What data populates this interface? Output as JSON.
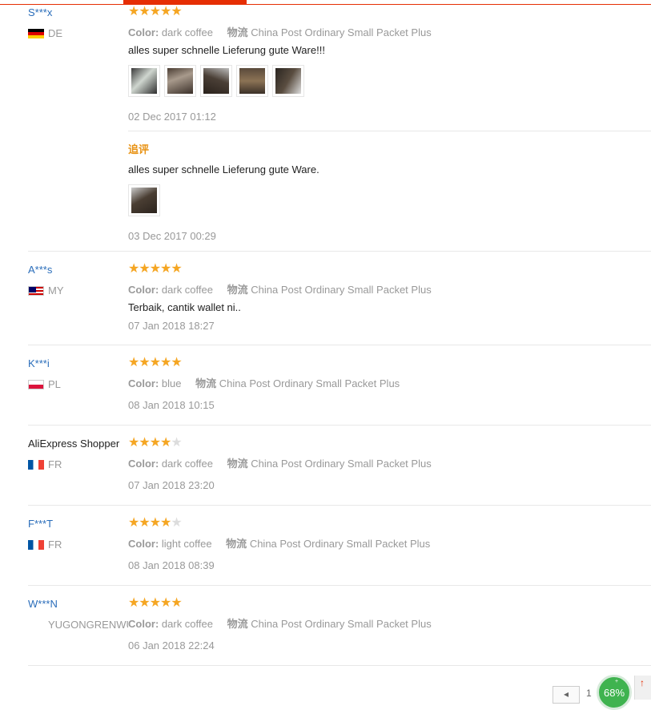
{
  "reviews": [
    {
      "user": "S***x",
      "country": "DE",
      "flag": "flag-de",
      "stars": 5,
      "color_label": "Color:",
      "color_value": "dark coffee",
      "shipping_label": "物流",
      "shipping_value": "China Post Ordinary Small Packet Plus",
      "text": "alles super schnelle Lieferung gute Ware!!!",
      "date": "02 Dec 2017 01:12",
      "followup": {
        "label": "追评",
        "text": "alles super schnelle Lieferung gute Ware.",
        "date": "03 Dec 2017 00:29"
      }
    },
    {
      "user": "A***s",
      "country": "MY",
      "flag": "flag-my",
      "stars": 5,
      "color_label": "Color:",
      "color_value": "dark coffee",
      "shipping_label": "物流",
      "shipping_value": "China Post Ordinary Small Packet Plus",
      "text": "Terbaik, cantik wallet ni..",
      "date": "07 Jan 2018 18:27"
    },
    {
      "user": "K***i",
      "country": "PL",
      "flag": "flag-pl",
      "stars": 5,
      "color_label": "Color:",
      "color_value": "blue",
      "shipping_label": "物流",
      "shipping_value": "China Post Ordinary Small Packet Plus",
      "date": "08 Jan 2018 10:15"
    },
    {
      "user": "AliExpress Shopper",
      "country": "FR",
      "flag": "flag-fr",
      "stars": 4,
      "color_label": "Color:",
      "color_value": "dark coffee",
      "shipping_label": "物流",
      "shipping_value": "China Post Ordinary Small Packet Plus",
      "date": "07 Jan 2018 23:20"
    },
    {
      "user": "F***T",
      "country": "FR",
      "flag": "flag-fr",
      "stars": 4,
      "color_label": "Color:",
      "color_value": "light coffee",
      "shipping_label": "物流",
      "shipping_value": "China Post Ordinary Small Packet Plus",
      "date": "08 Jan 2018 08:39"
    },
    {
      "user": "W***N",
      "country": "YUGONGRENWU",
      "stars": 5,
      "color_label": "Color:",
      "color_value": "dark coffee",
      "shipping_label": "物流",
      "shipping_value": "China Post Ordinary Small Packet Plus",
      "date": "06 Jan 2018 22:24"
    }
  ],
  "pagination": {
    "prev": "◂",
    "current": "1"
  },
  "badge": {
    "value": "68%",
    "arrow": "↑",
    "tick": "+"
  },
  "colors": {
    "accent": "#e62e04",
    "star": "#f5a623",
    "link": "#2a6dba"
  }
}
